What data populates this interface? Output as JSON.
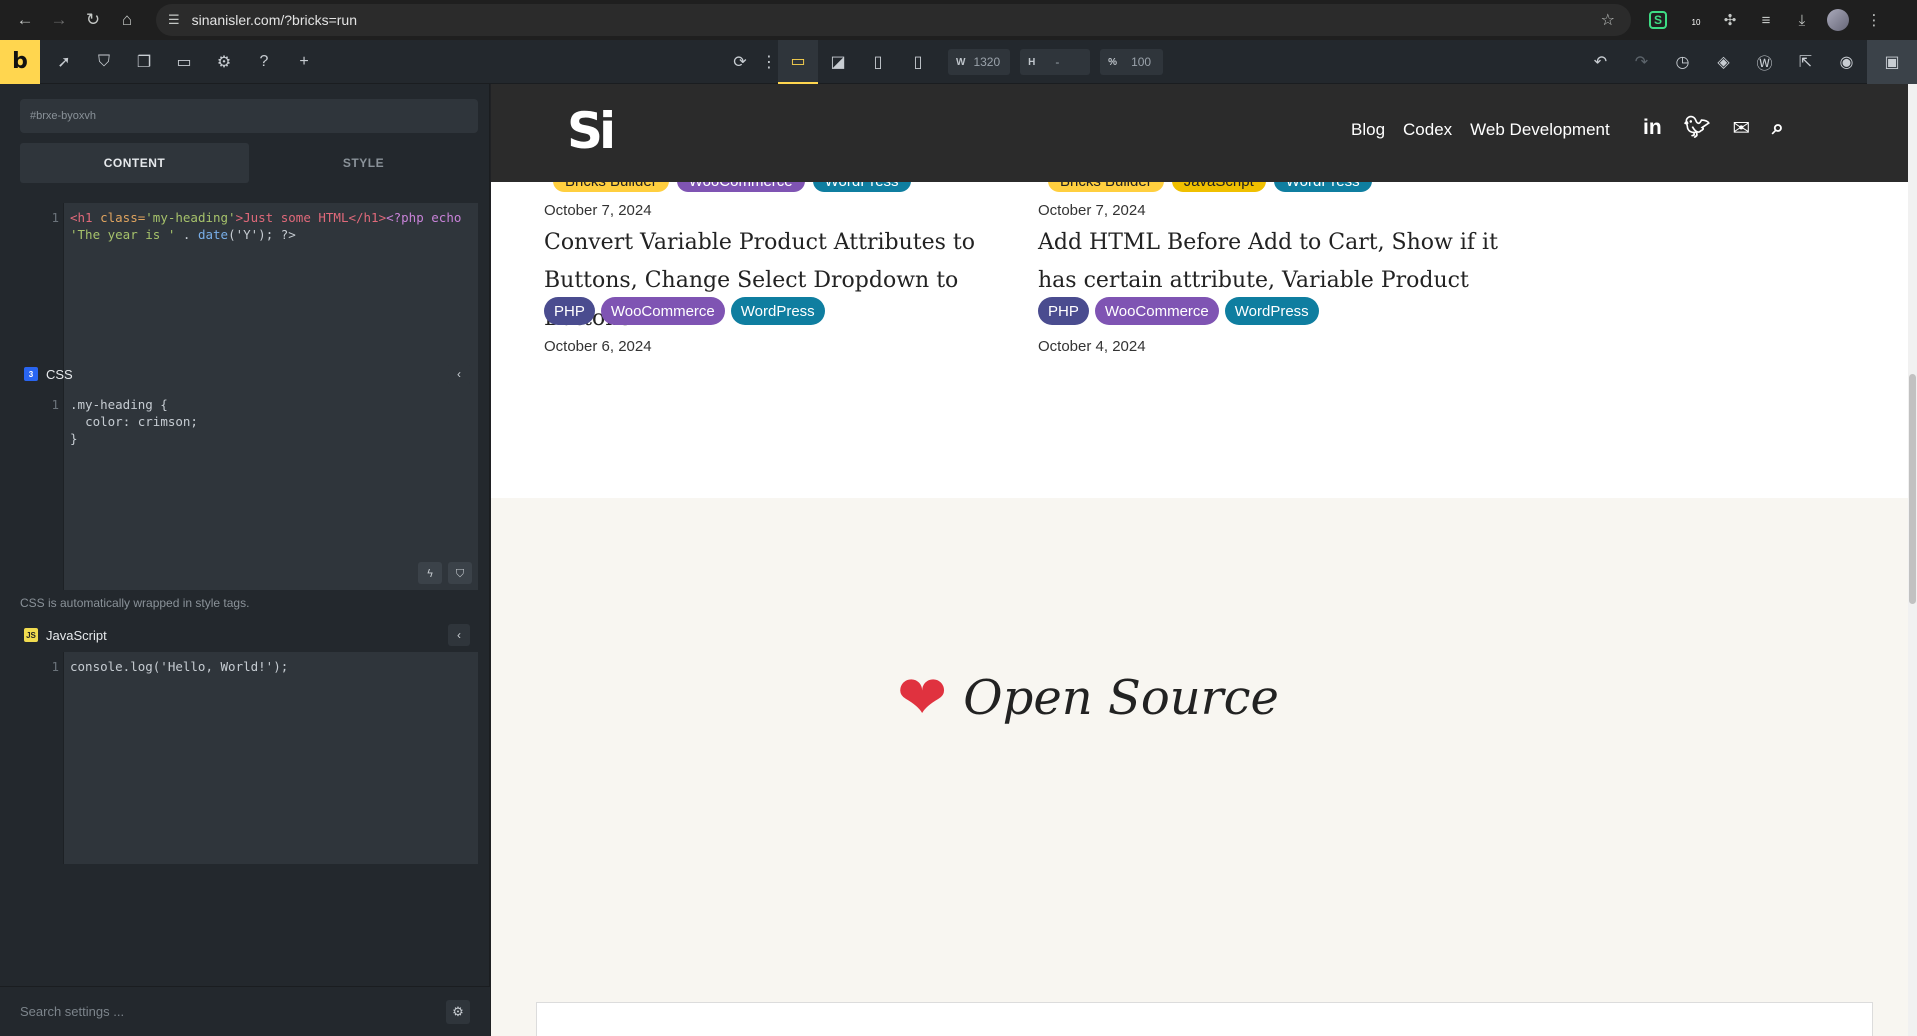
{
  "browser": {
    "url": "sinanisler.com/?bricks=run",
    "extension_badge": "10"
  },
  "builder": {
    "logo": "b",
    "width_label": "W",
    "width_value": "1320",
    "height_label": "H",
    "height_value": "-",
    "zoom_label": "%",
    "zoom_value": "100",
    "element_id": "#brxe-byoxvh",
    "tabs": {
      "content": "CONTENT",
      "style": "STYLE"
    },
    "html_code": {
      "line_no": "1",
      "tag_open": "<h1 ",
      "attr": "class=",
      "attr_val": "'my-heading'",
      "gt": ">",
      "text": "Just some HTML",
      "tag_close": "</h1>",
      "php_open": "<?php ",
      "kw": "echo ",
      "str": "'The year is ' ",
      "dot": ". ",
      "fn": "date",
      "args": "('Y'); ?>"
    },
    "css_section": {
      "title": "CSS",
      "line_numbers": "1",
      "code": ".my-heading {\n  color: crimson;\n}",
      "hint": "CSS is automatically wrapped in style tags."
    },
    "js_section": {
      "title": "JavaScript",
      "icon_text": "JS",
      "line_numbers": "1",
      "code": "console.log('Hello, World!');"
    },
    "search_placeholder": "Search settings ..."
  },
  "site": {
    "logo": "Si",
    "nav": [
      "Blog",
      "Codex",
      "Web Development"
    ],
    "top_badges_left": [
      "Bricks Builder",
      "WooCommerce",
      "WordPress"
    ],
    "top_badges_right": [
      "Bricks Builder",
      "JavaScript",
      "WordPress"
    ],
    "top_dates": [
      "October 7, 2024",
      "October 7, 2024"
    ],
    "posts": [
      {
        "title": "Convert Variable Product Attributes to Buttons, Change Select Dropdown to Buttons",
        "tags": [
          "PHP",
          "WooCommerce",
          "WordPress"
        ],
        "date": "October 6, 2024"
      },
      {
        "title": "Add HTML Before Add to Cart, Show if it has certain attribute, Variable Product",
        "tags": [
          "PHP",
          "WooCommerce",
          "WordPress"
        ],
        "date": "October 4, 2024"
      }
    ],
    "open_source": "Open Source"
  },
  "colors": {
    "accent_yellow": "#ffd64f",
    "heart_red": "#e0323f",
    "php": "#4a4c8f",
    "woocommerce": "#7f54b3",
    "wordpress": "#0f7ea0"
  }
}
